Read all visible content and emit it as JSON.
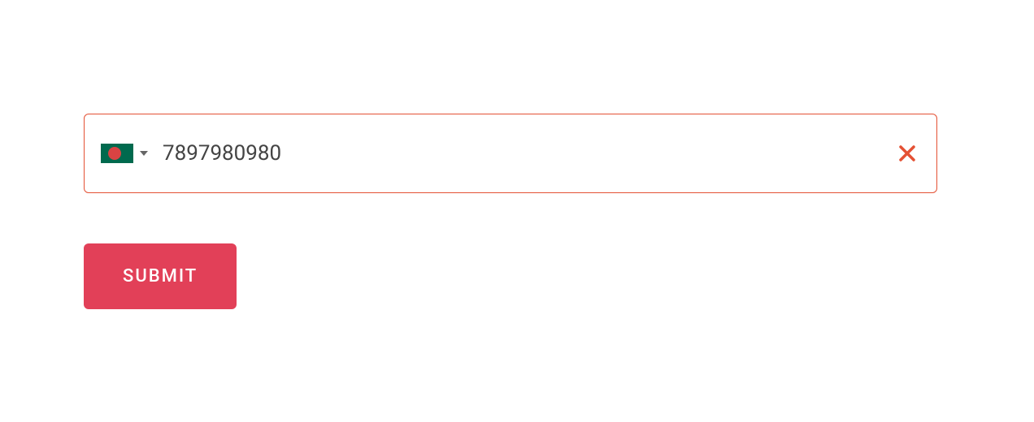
{
  "phone": {
    "value": "7897980980",
    "country": "Bangladesh",
    "flag_colors": {
      "bg": "#006a4e",
      "circle": "#d94343"
    }
  },
  "submit_label": "SUBMIT",
  "icons": {
    "clear": "close-icon",
    "chevron": "chevron-down-icon"
  },
  "colors": {
    "border_error": "#e45134",
    "submit_bg": "#e24058"
  }
}
